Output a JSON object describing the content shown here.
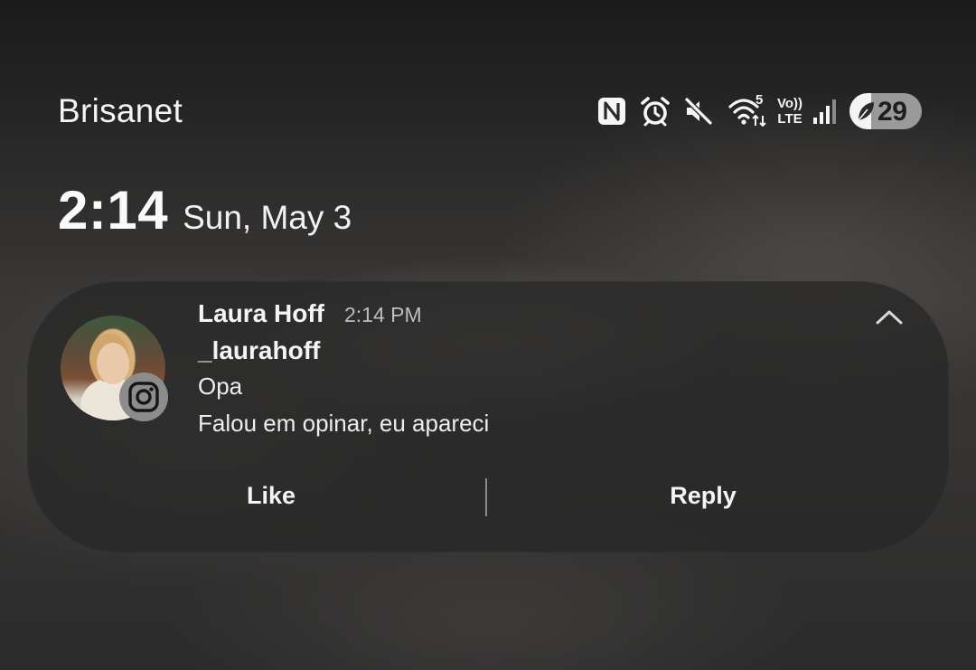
{
  "status_bar": {
    "carrier": "Brisanet",
    "icons": [
      "nfc-icon",
      "alarm-icon",
      "mute-icon",
      "wifi-icon",
      "volte-lte-icon",
      "signal-icon",
      "battery-icon"
    ],
    "wifi_label": "5",
    "volte_label": "Vo))",
    "lte_label": "LTE",
    "battery_level": "29"
  },
  "lockscreen": {
    "time": "2:14",
    "date": "Sun, May 3"
  },
  "notification": {
    "sender": "Laura Hoff",
    "time": "2:14 PM",
    "username": "_laurahoff",
    "lines": [
      "Opa",
      "Falou em opinar, eu apareci"
    ],
    "app_icon": "instagram-icon",
    "actions": {
      "like": "Like",
      "reply": "Reply"
    }
  },
  "colors": {
    "card_bg": "#282828",
    "badge_bg": "#8c8c8c",
    "text": "#f4f4f4",
    "muted_text": "#bdbdbd"
  }
}
